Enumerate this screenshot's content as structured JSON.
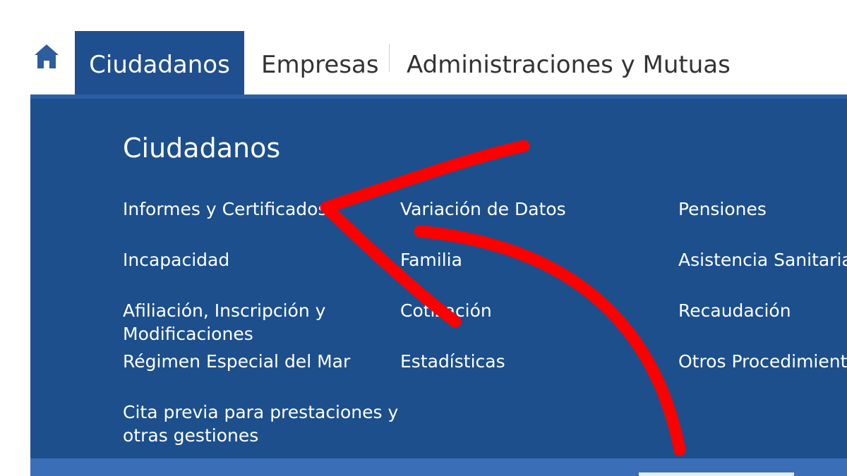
{
  "nav": {
    "home_icon": "home-icon",
    "tabs": [
      {
        "label": "Ciudadanos",
        "active": true
      },
      {
        "label": "Empresas",
        "active": false
      },
      {
        "label": "Administraciones y Mutuas",
        "active": false
      }
    ]
  },
  "panel": {
    "title": "Ciudadanos",
    "columns": [
      {
        "items": [
          {
            "label": "Informes y Certificados"
          },
          {
            "label": "Incapacidad"
          },
          {
            "label": "Afiliación, Inscripción y\nModificaciones"
          },
          {
            "label": "Régimen Especial del Mar"
          },
          {
            "label": "Cita previa para prestaciones y\notras gestiones"
          }
        ]
      },
      {
        "items": [
          {
            "label": "Variación de Datos"
          },
          {
            "label": "Familia"
          },
          {
            "label": "Cotización"
          },
          {
            "label": "Estadísticas"
          }
        ]
      },
      {
        "items": [
          {
            "label": "Pensiones"
          },
          {
            "label": "Asistencia Sanitaria"
          },
          {
            "label": "Recaudación"
          },
          {
            "label": "Otros Procedimientos"
          }
        ]
      }
    ]
  },
  "colors": {
    "brand_blue": "#1c4f8c",
    "active_tab": "#1f4f8f",
    "annotation_red": "#ff0000",
    "text_dark": "#333333"
  }
}
